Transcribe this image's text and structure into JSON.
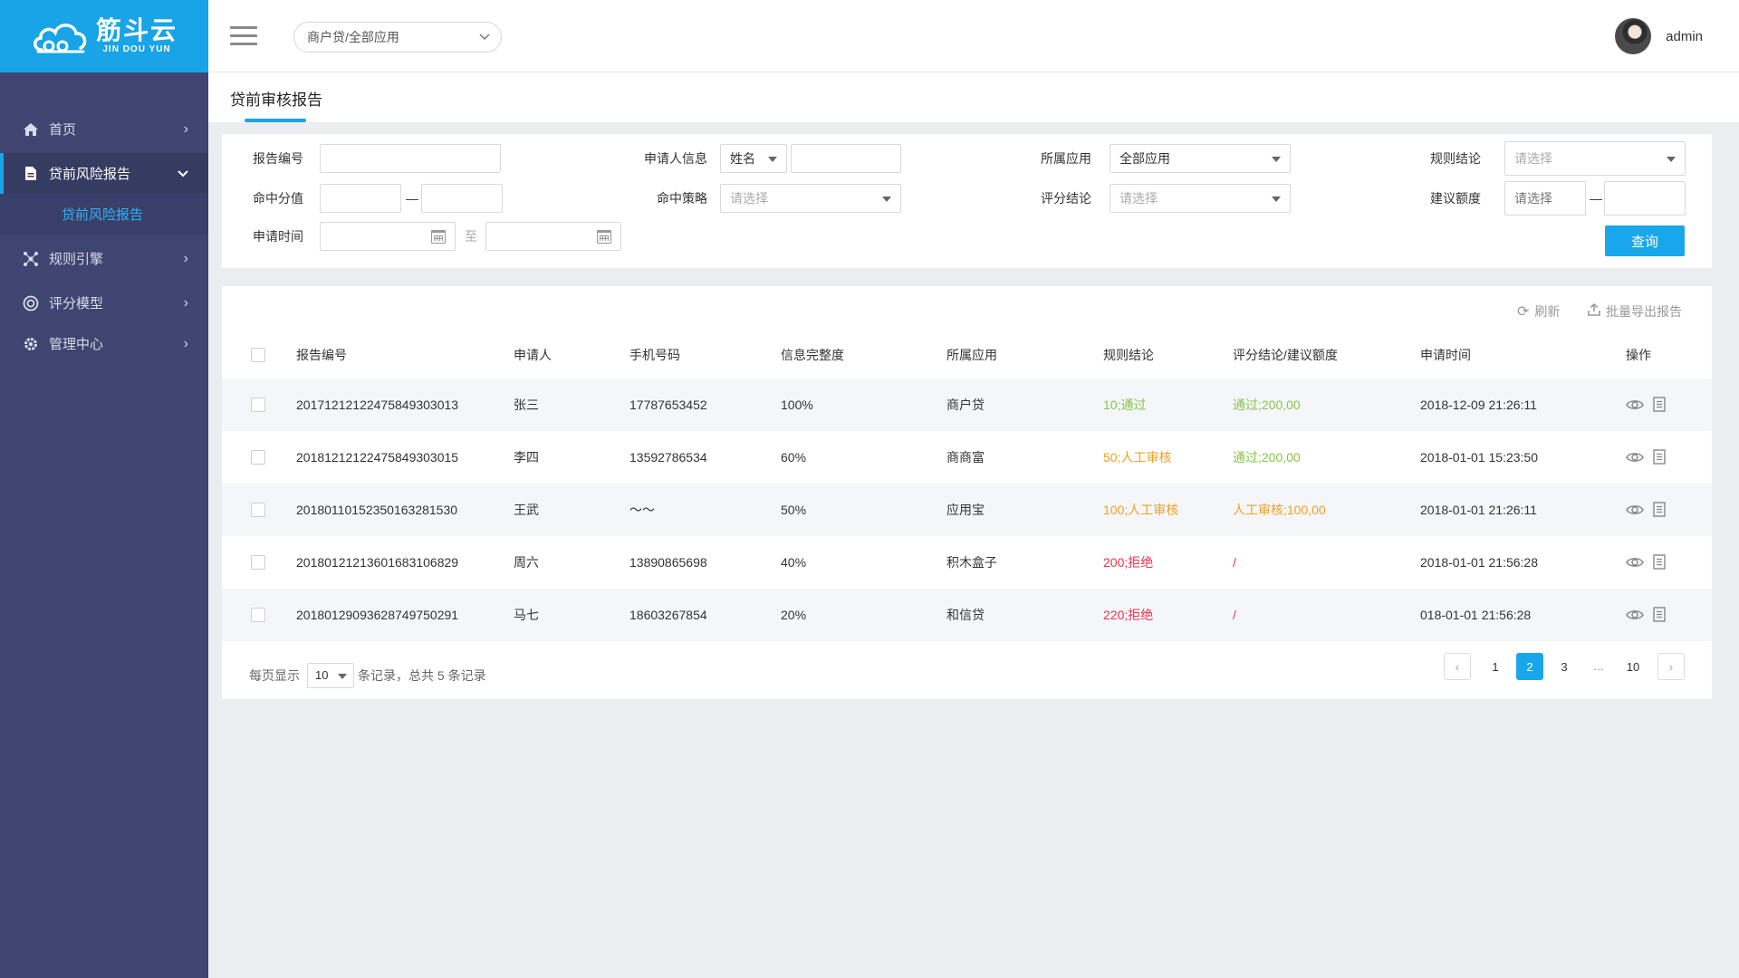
{
  "brand": {
    "name_cn": "筋斗云",
    "name_en": "JIN DOU YUN",
    "color": "#18a4e6"
  },
  "header": {
    "app_select": "商户贷/全部应用",
    "username": "admin"
  },
  "sidebar": {
    "items": [
      {
        "label": "首页",
        "icon": "home-icon"
      },
      {
        "label": "贷前风险报告",
        "icon": "document-icon"
      },
      {
        "label": "规则引擎",
        "icon": "network-icon"
      },
      {
        "label": "评分模型",
        "icon": "target-icon"
      },
      {
        "label": "管理中心",
        "icon": "gear-icon"
      }
    ],
    "submenu": {
      "label": "贷前风险报告"
    }
  },
  "page": {
    "title": "贷前审核报告"
  },
  "filters": {
    "report_no_label": "报告编号",
    "applicant_info_label": "申请人信息",
    "applicant_info_type": "姓名",
    "app_label": "所属应用",
    "app_value": "全部应用",
    "rule_result_label": "规则结论",
    "rule_result_placeholder": "请选择",
    "hit_score_label": "命中分值",
    "hit_strategy_label": "命中策略",
    "hit_strategy_placeholder": "请选择",
    "score_result_label": "评分结论",
    "score_result_placeholder": "请选择",
    "suggest_amount_label": "建议额度",
    "suggest_amount_placeholder": "请选择",
    "apply_time_label": "申请时间",
    "range_dash": "—",
    "date_to": "至",
    "query_button": "查询"
  },
  "toolbar": {
    "refresh": "刷新",
    "export": "批量导出报告"
  },
  "table": {
    "columns": [
      "报告编号",
      "申请人",
      "手机号码",
      "信息完整度",
      "所属应用",
      "规则结论",
      "评分结论/建议额度",
      "申请时间",
      "操作"
    ],
    "rows": [
      {
        "report_no": "20171212122475849303013",
        "name": "张三",
        "phone": "17787653452",
        "completeness": "100%",
        "app": "商户贷",
        "rule": "10;通过",
        "rule_color": "green",
        "score": "通过;200,00",
        "score_color": "green",
        "time": "2018-12-09  21:26:11"
      },
      {
        "report_no": "20181212122475849303015",
        "name": "李四",
        "phone": "13592786534",
        "completeness": "60%",
        "app": "商商富",
        "rule": "50;人工审核",
        "rule_color": "orange",
        "score": "通过;200,00",
        "score_color": "green",
        "time": "2018-01-01  15:23:50"
      },
      {
        "report_no": "20180110152350163281530",
        "name": "王武",
        "phone": "～～",
        "completeness": "50%",
        "app": "应用宝",
        "rule": "100;人工审核",
        "rule_color": "orange",
        "score": "人工审核;100,00",
        "score_color": "orange",
        "time": "2018-01-01  21:26:11"
      },
      {
        "report_no": "20180121213601683106829",
        "name": "周六",
        "phone": "13890865698",
        "completeness": "40%",
        "app": "积木盒子",
        "rule": "200;拒绝",
        "rule_color": "red",
        "score": "/",
        "score_color": "red",
        "time": "2018-01-01  21:56:28"
      },
      {
        "report_no": "20180129093628749750291",
        "name": "马七",
        "phone": "18603267854",
        "completeness": "20%",
        "app": "和信贷",
        "rule": "220;拒绝",
        "rule_color": "red",
        "score": "/",
        "score_color": "red",
        "time": "018-01-01  21:56:28"
      }
    ]
  },
  "pagination": {
    "per_page_label": "每页显示",
    "per_page_value": "10",
    "summary": "条记录，总共 5 条记录",
    "pages": [
      "1",
      "2",
      "3",
      "…",
      "10"
    ],
    "current": "2"
  }
}
